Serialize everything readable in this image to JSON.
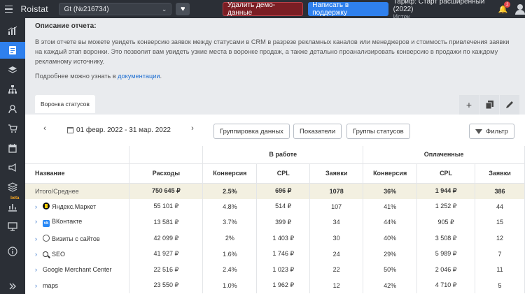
{
  "topbar": {
    "logo": "Roistat",
    "project": "Gt (№216734)",
    "delete_demo": "Удалить демо-данные",
    "support": "Написать в поддержку",
    "tariff": "Тариф: Старт расширенный (2022)",
    "tariff_status": "Истек",
    "notifications_count": "2"
  },
  "sidebar": {
    "icons": [
      "dashboard-icon",
      "reports-icon",
      "layers-icon",
      "sitemap-icon",
      "users-icon",
      "cart-icon",
      "calendar-icon",
      "megaphone-icon",
      "stack-icon",
      "chart-beta-icon",
      "monitor-icon",
      "info-icon",
      "expand-icon"
    ],
    "beta_label": "beta",
    "active_index": 1
  },
  "description": {
    "title": "Описание отчета:",
    "text": "В этом отчете вы можете увидеть конверсию заявок между статусами в CRM в разрезе рекламных каналов или менеджеров и стоимость привлечения заявки на каждый этап воронки. Это позволит вам увидеть узкие места в воронке продаж, а также детально проанализировать конверсию в продажи по каждому рекламному источнику.",
    "more_prefix": "Подробнее можно узнать в ",
    "more_link": "документации",
    "more_suffix": "."
  },
  "tabs": [
    {
      "label": "Воронка статусов"
    }
  ],
  "filters": {
    "prev": "‹",
    "next": "›",
    "date_range": "01 февр. 2022 - 31 мар. 2022",
    "grouping": "Группировка данных",
    "metrics": "Показатели",
    "status_groups": "Группы статусов",
    "filter": "Фильтр"
  },
  "table": {
    "group_headers": {
      "in_work": "В работе",
      "paid": "Оплаченные"
    },
    "columns": [
      "Название",
      "Расходы",
      "Конверсия",
      "CPL",
      "Заявки",
      "Конверсия",
      "CPL",
      "Заявки"
    ],
    "total": {
      "name": "Итого/Среднее",
      "cells": [
        "750 645 ₽",
        "2.5%",
        "696 ₽",
        "1078",
        "36%",
        "1 944 ₽",
        "386"
      ]
    },
    "rows": [
      {
        "name": "Яндекс.Маркет",
        "icon": "yandex-market-icon",
        "cells": [
          "55 101 ₽",
          "4.8%",
          "514 ₽",
          "107",
          "41%",
          "1 252 ₽",
          "44"
        ]
      },
      {
        "name": "ВКонтакте",
        "icon": "vk-icon",
        "cells": [
          "13 581 ₽",
          "3.7%",
          "399 ₽",
          "34",
          "44%",
          "905 ₽",
          "15"
        ]
      },
      {
        "name": "Визиты с сайтов",
        "icon": "globe-icon",
        "cells": [
          "42 099 ₽",
          "2%",
          "1 403 ₽",
          "30",
          "40%",
          "3 508 ₽",
          "12"
        ]
      },
      {
        "name": "SEO",
        "icon": "search-icon",
        "cells": [
          "41 927 ₽",
          "1.6%",
          "1 746 ₽",
          "24",
          "29%",
          "5 989 ₽",
          "7"
        ]
      },
      {
        "name": "Google Merchant Center",
        "icon": "",
        "cells": [
          "22 516 ₽",
          "2.4%",
          "1 023 ₽",
          "22",
          "50%",
          "2 046 ₽",
          "11"
        ]
      },
      {
        "name": "maps",
        "icon": "",
        "cells": [
          "23 550 ₽",
          "1.0%",
          "1 962 ₽",
          "12",
          "42%",
          "4 710 ₽",
          "5"
        ]
      }
    ]
  }
}
